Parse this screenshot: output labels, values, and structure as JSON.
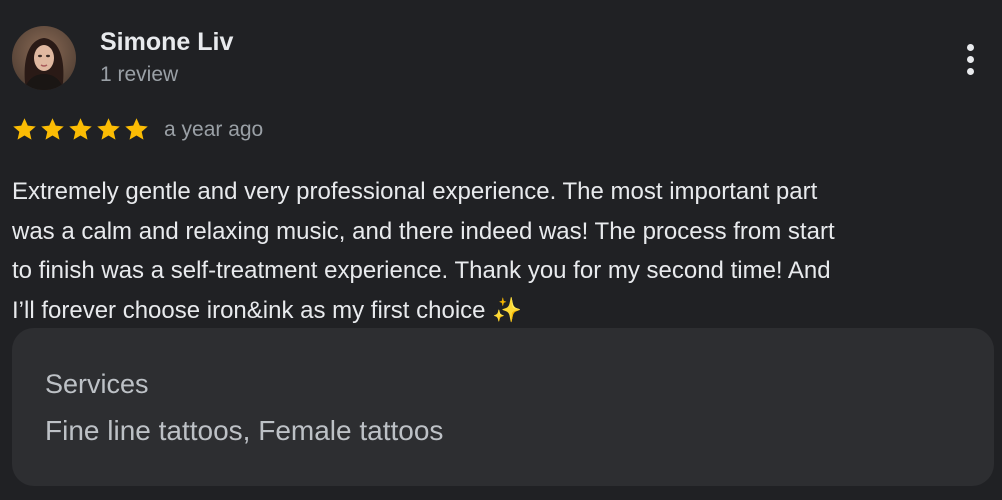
{
  "reviewer": {
    "name": "Simone Liv",
    "review_count": "1 review",
    "avatar_icon": "profile-photo"
  },
  "menu": {
    "icon": "more-vert-icon"
  },
  "rating": {
    "stars": 5,
    "max": 5,
    "star_color": "#fbbc04",
    "time": "a year ago"
  },
  "review": {
    "lines": [
      "Extremely gentle and very professional experience. The most important part",
      "was a calm and relaxing music, and there indeed was! The process from start",
      "to finish was a self-treatment experience. Thank you for my second time! And",
      "I’ll forever choose iron&ink as my first choice ✨"
    ]
  },
  "services": {
    "title": "Services",
    "value": "Fine line tattoos, Female tattoos"
  },
  "colors": {
    "background": "#202124",
    "card": "#2d2e31",
    "primary_text": "#e8eaed",
    "secondary_text": "#9aa0a6"
  }
}
